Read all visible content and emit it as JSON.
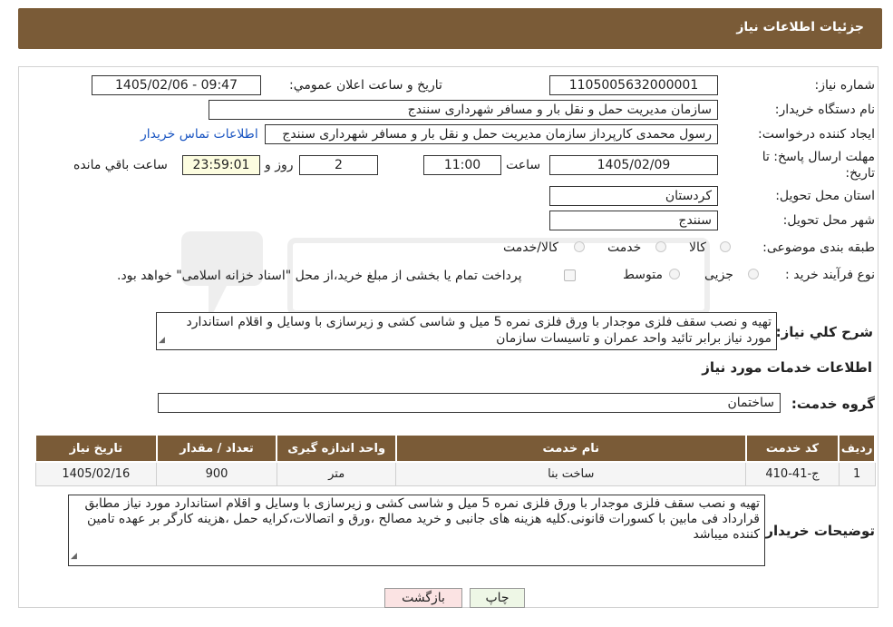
{
  "header": {
    "title": "جزئیات اطلاعات نیاز"
  },
  "form": {
    "need_number_label": "شماره نياز:",
    "need_number": "1105005632000001",
    "announce_label": "تاريخ و ساعت اعلان عمومي:",
    "announce_value": "1405/02/06 - 09:47",
    "buyer_org_label": "نام دستگاه خريدار:",
    "buyer_org": "سازمان مدیریت حمل و نقل بار و مسافر شهرداری سنندج",
    "creator_label": "ايجاد کننده درخواست:",
    "creator": "رسول محمدی کارپرداز سازمان مدیریت حمل و نقل بار و مسافر شهرداری سنندج",
    "contact_link": "اطلاعات تماس خریدار",
    "deadline_label_1": "مهلت ارسال پاسخ: تا",
    "deadline_label_2": "تاريخ:",
    "deadline_date": "1405/02/09",
    "time_label": "ساعت",
    "deadline_time": "11:00",
    "days_value": "2",
    "days_label": "روز و",
    "remaining_time": "23:59:01",
    "remaining_label": "ساعت باقي مانده",
    "province_label": "استان محل تحویل:",
    "province": "کردستان",
    "city_label": "شهر محل تحویل:",
    "city": "سنندج",
    "category_label": "طبقه بندی موضوعی:",
    "category_options": [
      "کالا",
      "خدمت",
      "کالا/خدمت"
    ],
    "purchase_type_label": "نوع فرآیند خرید :",
    "purchase_options": [
      "جزیی",
      "متوسط"
    ],
    "payment_note": "پرداخت تمام يا بخشی از مبلغ خريد،از محل \"اسناد خزانه اسلامی\" خواهد بود.",
    "summary_label": "شرح کلي نياز:",
    "summary": "تهیه و نصب سقف فلزی موجدار با ورق فلزی نمره 5 میل و شاسی کشی و زیرسازی با وسایل و اقلام استاندارد مورد نیاز برابر تائید واحد عمران و تاسیسات سازمان"
  },
  "services": {
    "section_title": "اطلاعات خدمات مورد نياز",
    "group_label": "گروه خدمت:",
    "group_value": "ساختمان",
    "columns": [
      "رديف",
      "کد خدمت",
      "نام خدمت",
      "واحد اندازه گيری",
      "تعداد / مقدار",
      "تاريخ نياز"
    ],
    "rows": [
      {
        "row": "1",
        "code": "ج-41-410",
        "name": "ساخت بنا",
        "unit": "متر",
        "qty": "900",
        "date": "1405/02/16"
      }
    ]
  },
  "buyer_notes": {
    "label": "توضيحات خريدار:",
    "text": "تهیه و نصب سقف فلزی موجدار با ورق فلزی نمره 5 میل و شاسی کشی و زیرسازی با وسایل و اقلام استاندارد مورد نیاز مطابق قرارداد فی مابین با کسورات قانونی.کلیه هزینه های جانبی و خرید مصالح ،ورق و اتصالات،کرایه حمل ،هزینه کارگر بر عهده تامین کننده میباشد"
  },
  "buttons": {
    "print": "چاپ",
    "back": "بازگشت"
  },
  "colors": {
    "header": "#7a5b37",
    "link": "#1b56c2",
    "back_button": "#fbe3e3",
    "print_button": "#eef7e6"
  }
}
